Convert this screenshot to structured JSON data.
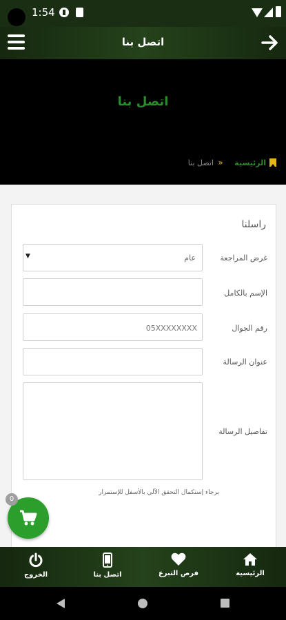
{
  "status_bar": {
    "time": "1:54"
  },
  "app_bar": {
    "title": "اتصل بنا"
  },
  "hero": {
    "title": "اتصل بنا",
    "breadcrumb": {
      "home": "الرئيسية",
      "separator": "»",
      "current": "اتصل بنا"
    }
  },
  "form": {
    "title": "راسلنا",
    "purpose_label": "غرض المراجعة",
    "purpose_value": "عام",
    "name_label": "الإسم بالكامل",
    "mobile_label": "رقم الجوال",
    "mobile_placeholder": "05XXXXXXXX",
    "subject_label": "عنوان الرسالة",
    "details_label": "تفاصيل الرسالة",
    "captcha_note": "برجاء إستكمال التحقق الآلي بالأسفل للإستمرار"
  },
  "cart": {
    "count": "0"
  },
  "bottom_nav": {
    "items": [
      {
        "label": "الرئيسية",
        "icon": "home-icon"
      },
      {
        "label": "فرص التبرع",
        "icon": "heart-icon"
      },
      {
        "label": "اتصل بنا",
        "icon": "phone-icon"
      },
      {
        "label": "الخروج",
        "icon": "power-icon"
      }
    ]
  },
  "colors": {
    "brand_green": "#2b8a2a",
    "bar_dark": "#1a2e14",
    "accent_gold": "#e2b616"
  }
}
